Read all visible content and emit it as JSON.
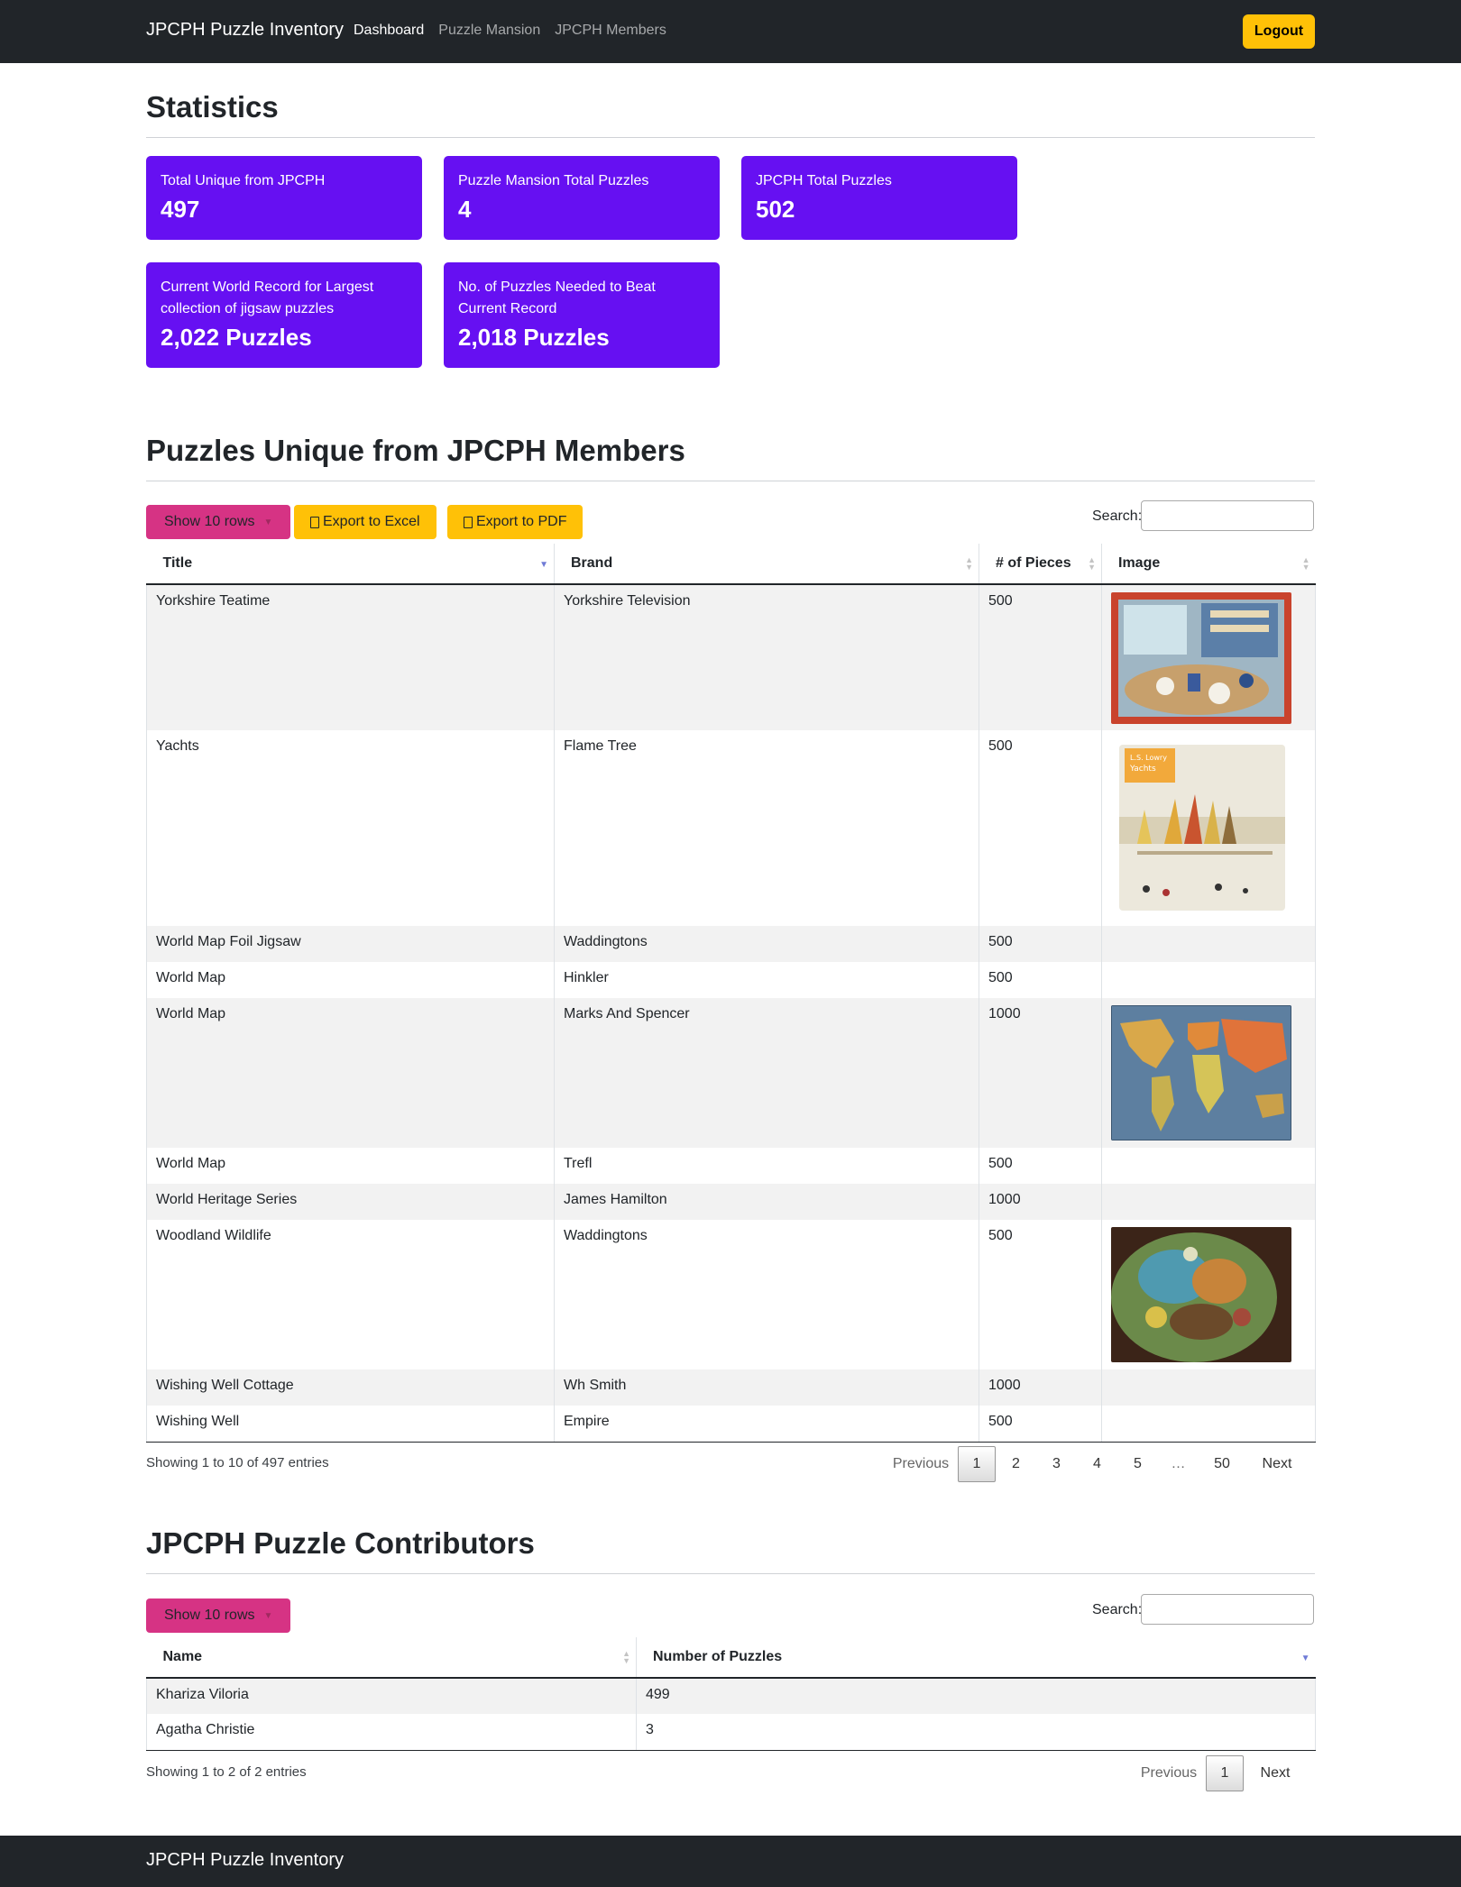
{
  "navbar": {
    "brand": "JPCPH Puzzle Inventory",
    "links": [
      "Dashboard",
      "Puzzle Mansion",
      "JPCPH Members"
    ],
    "logout": "Logout"
  },
  "stats": {
    "title": "Statistics",
    "cards": [
      {
        "label": "Total Unique from JPCPH",
        "value": "497"
      },
      {
        "label": "Puzzle Mansion Total Puzzles",
        "value": "4"
      },
      {
        "label": "JPCPH Total Puzzles",
        "value": "502"
      },
      {
        "label": "Current World Record for Largest collection of jigsaw puzzles",
        "value": "2,022 Puzzles"
      },
      {
        "label": "No. of Puzzles Needed to Beat Current Record",
        "value": "2,018 Puzzles"
      }
    ]
  },
  "unique": {
    "title": "Puzzles Unique from JPCPH Members",
    "show_rows": "Show 10 rows",
    "export_excel": "Export to Excel",
    "export_pdf": "Export to PDF",
    "search_label": "Search:",
    "columns": [
      "Title",
      "Brand",
      "# of Pieces",
      "Image"
    ],
    "rows": [
      {
        "title": "Yorkshire Teatime",
        "brand": "Yorkshire Television",
        "pieces": "500",
        "image": "teatime"
      },
      {
        "title": "Yachts",
        "brand": "Flame Tree",
        "pieces": "500",
        "image": "yachts"
      },
      {
        "title": "World Map Foil Jigsaw",
        "brand": "Waddingtons",
        "pieces": "500",
        "image": ""
      },
      {
        "title": "World Map",
        "brand": "Hinkler",
        "pieces": "500",
        "image": ""
      },
      {
        "title": "World Map",
        "brand": "Marks And Spencer",
        "pieces": "1000",
        "image": "worldmap"
      },
      {
        "title": "World Map",
        "brand": "Trefl",
        "pieces": "500",
        "image": ""
      },
      {
        "title": "World Heritage Series",
        "brand": "James Hamilton",
        "pieces": "1000",
        "image": ""
      },
      {
        "title": "Woodland Wildlife",
        "brand": "Waddingtons",
        "pieces": "500",
        "image": "woodland"
      },
      {
        "title": "Wishing Well Cottage",
        "brand": "Wh Smith",
        "pieces": "1000",
        "image": ""
      },
      {
        "title": "Wishing Well",
        "brand": "Empire",
        "pieces": "500",
        "image": ""
      }
    ],
    "yachts_box_text_1": "L.S. Lowry",
    "yachts_box_text_2": "Yachts",
    "info": "Showing 1 to 10 of 497 entries",
    "pager": [
      "Previous",
      "1",
      "2",
      "3",
      "4",
      "5",
      "…",
      "50",
      "Next"
    ]
  },
  "contributors": {
    "title": "JPCPH Puzzle Contributors",
    "show_rows": "Show 10 rows",
    "search_label": "Search:",
    "columns": [
      "Name",
      "Number of Puzzles"
    ],
    "rows": [
      {
        "name": "Khariza Viloria",
        "count": "499"
      },
      {
        "name": "Agatha Christie",
        "count": "3"
      }
    ],
    "info": "Showing 1 to 2 of 2 entries",
    "pager": [
      "Previous",
      "1",
      "Next"
    ]
  },
  "footer": {
    "brand": "JPCPH Puzzle Inventory"
  },
  "colors": {
    "card": "#6610f2",
    "show_rows": "#d63384",
    "export": "#ffc107",
    "navbar": "#212529"
  }
}
